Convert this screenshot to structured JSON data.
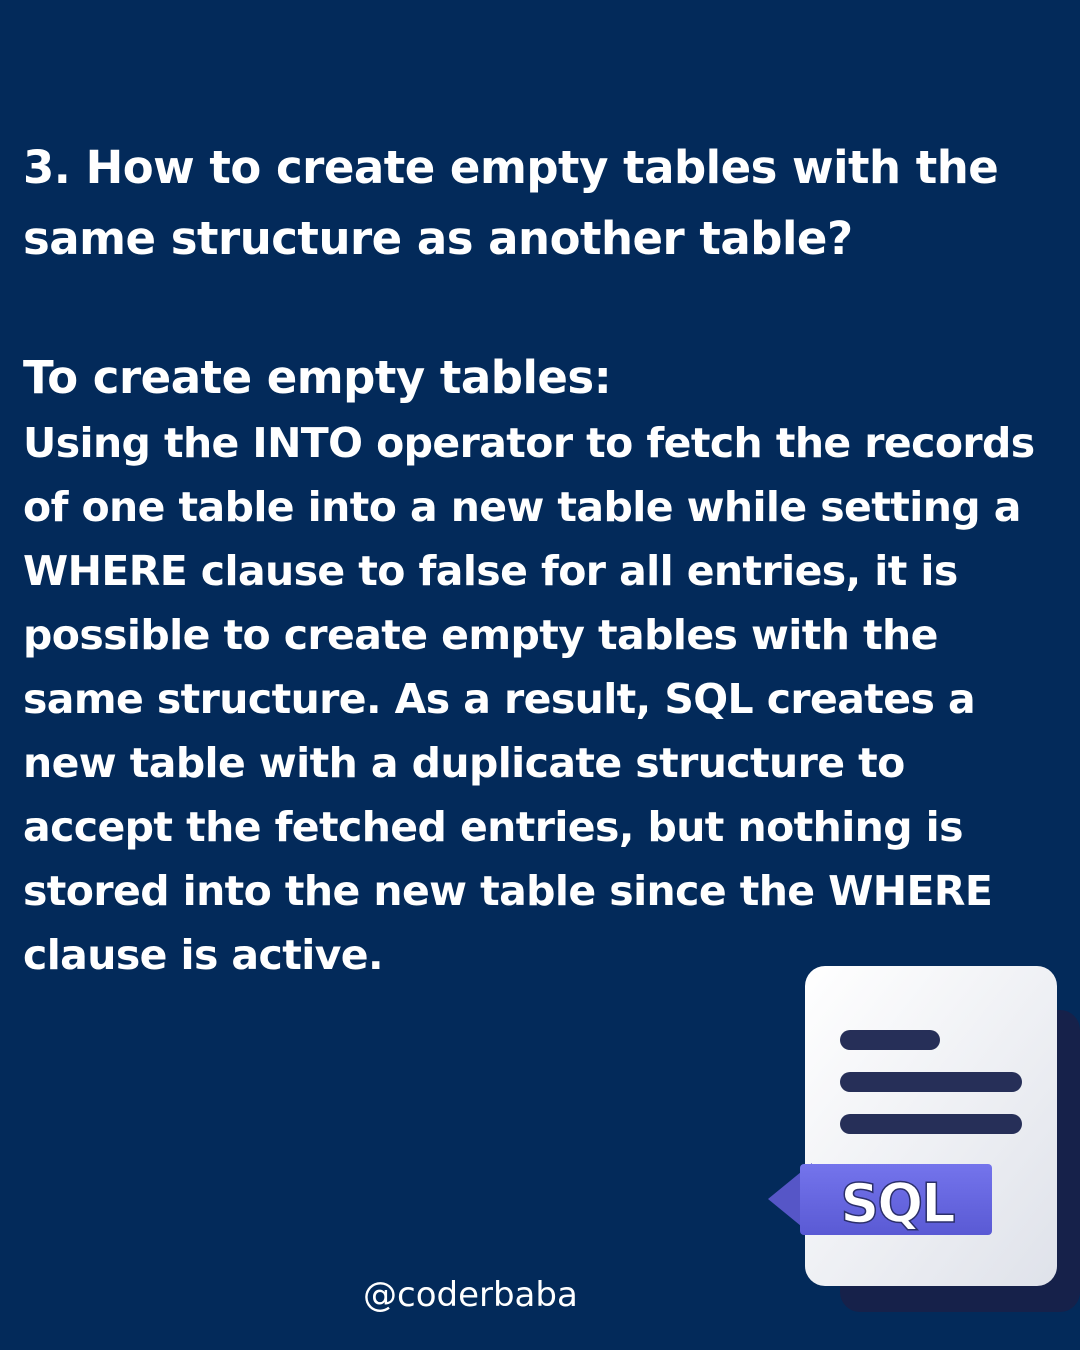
{
  "question": {
    "text": "3. How to create empty tables with the same structure as another table?"
  },
  "answer": {
    "heading": "To create empty tables:",
    "body": "Using the INTO operator to fetch the records of one table into a new table while setting a WHERE clause to false for all entries, it is possible to create empty tables with the same structure. As a result, SQL creates a new table with a duplicate structure to accept the fetched entries, but nothing is stored into the new table since the WHERE clause is active."
  },
  "footer": {
    "handle": "@coderbaba"
  },
  "illustration": {
    "icon": "sql-document-icon",
    "badge_label": "SQL",
    "colors": {
      "background": "#032a5a",
      "paper": "#f2f3f7",
      "paper_back": "#16214a",
      "text_lines": "#262f58",
      "badge": "#6767e0",
      "badge_tail": "#5656c7"
    }
  }
}
